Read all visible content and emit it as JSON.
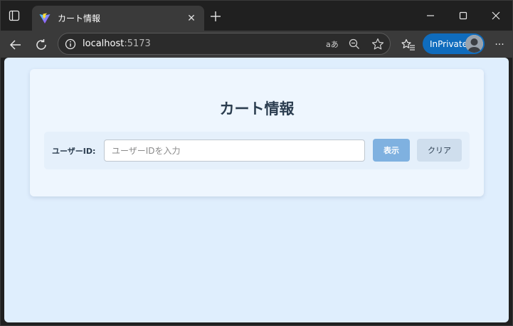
{
  "browser": {
    "tab": {
      "title": "カート情報",
      "close_glyph": "✕"
    },
    "new_tab_glyph": "+",
    "address": {
      "host": "localhost",
      "port": ":5173"
    },
    "inprivate_label": "InPrivate",
    "more_glyph": "···",
    "icons": [
      "tab-actions-icon",
      "vite-favicon-icon",
      "back-icon",
      "refresh-icon",
      "info-icon",
      "read-aloud-icon",
      "zoom-out-icon",
      "favorite-star-icon",
      "favorites-icon",
      "minimize-icon",
      "maximize-icon",
      "close-icon"
    ],
    "accent": "#0f6cbd"
  },
  "page": {
    "title": "カート情報",
    "form": {
      "label": "ユーザーID:",
      "input_placeholder": "ユーザーIDを入力",
      "input_value": "",
      "show_button": "表示",
      "clear_button": "クリア"
    },
    "colors": {
      "background": "#dfeefd",
      "card": "#eef6fe",
      "primary_button": "#7fb1e0",
      "secondary_button": "#cfdeed",
      "text": "#2c3e50"
    }
  }
}
